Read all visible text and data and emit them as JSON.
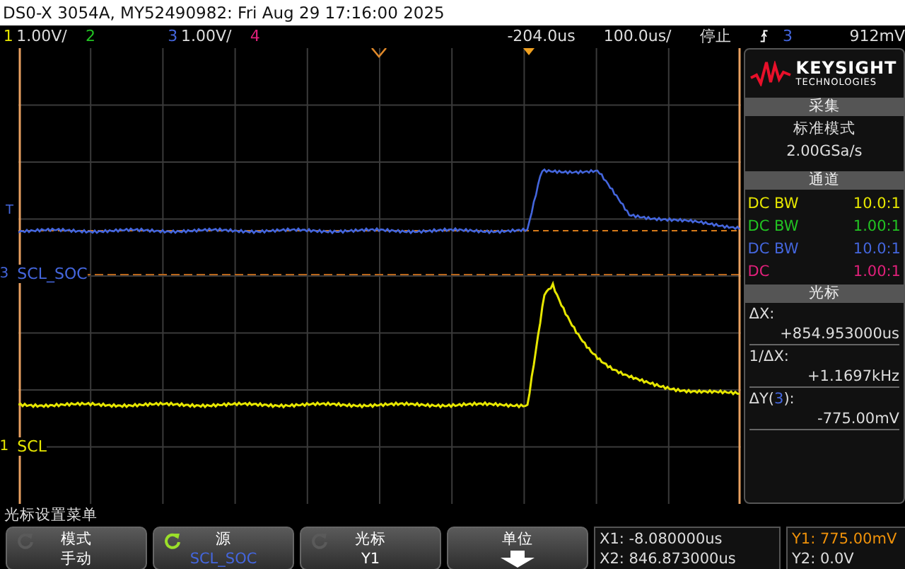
{
  "window": {
    "title": "DS0-X 3054A, MY52490982: Fri Aug 29 17:16:00 2025"
  },
  "status_bar": {
    "channels": [
      {
        "number": "1",
        "scale": "1.00V/",
        "color": "#e6e600"
      },
      {
        "number": "2",
        "color": "#22c322"
      },
      {
        "number": "3",
        "scale": "1.00V/",
        "color": "#4466dd"
      },
      {
        "number": "4",
        "color": "#e0207a"
      }
    ],
    "delay": "-204.0us",
    "timebase": "100.0us/",
    "run_state": "停止",
    "trigger_source": "3",
    "trigger_level": "912mV"
  },
  "display": {
    "trigger_marker": "T",
    "channel_labels": [
      {
        "number": "3",
        "name": "SCL_SOC",
        "color": "#4466dd"
      },
      {
        "number": "1",
        "name": "SCL",
        "color": "#e6e600"
      }
    ]
  },
  "side_panel": {
    "logo": {
      "brand": "KEYSIGHT",
      "tagline": "TECHNOLOGIES"
    },
    "acquisition": {
      "title": "采集",
      "mode": "标准模式",
      "rate": "2.00GSa/s"
    },
    "channels": {
      "title": "通道",
      "rows": [
        {
          "coupling": "DC BW",
          "probe": "10.0:1",
          "color": "#e6e600"
        },
        {
          "coupling": "DC BW",
          "probe": "1.00:1",
          "color": "#22c322"
        },
        {
          "coupling": "DC BW",
          "probe": "10.0:1",
          "color": "#4466dd"
        },
        {
          "coupling": "DC",
          "probe": "1.00:1",
          "color": "#e0207a"
        }
      ]
    },
    "cursors": {
      "title": "光标",
      "delta_x_label": "ΔX:",
      "delta_x": "+854.953000us",
      "inv_delta_x_label": "1/ΔX:",
      "inv_delta_x": "+1.1697kHz",
      "delta_y_prefix": "ΔY(",
      "delta_y_channel": "3",
      "delta_y_suffix": "):",
      "delta_y": "-775.00mV"
    }
  },
  "menu": {
    "title": "光标设置菜单",
    "softkeys": [
      {
        "kind": "value",
        "label": "模式",
        "value": "手动",
        "knob_active": false
      },
      {
        "kind": "source",
        "label": "源",
        "value": "SCL_SOC",
        "knob_active": true
      },
      {
        "kind": "value",
        "label": "光标",
        "value": "Y1",
        "knob_active": false
      },
      {
        "kind": "arrow",
        "label": "单位"
      }
    ],
    "readouts": [
      {
        "text": "X1: -8.080000us",
        "selected": false
      },
      {
        "text": "X2: 846.873000us",
        "selected": false
      }
    ],
    "readouts_y": [
      {
        "text": "Y1: 775.00mV",
        "selected": true
      },
      {
        "text": "Y2: 0.0V",
        "selected": false
      }
    ]
  }
}
